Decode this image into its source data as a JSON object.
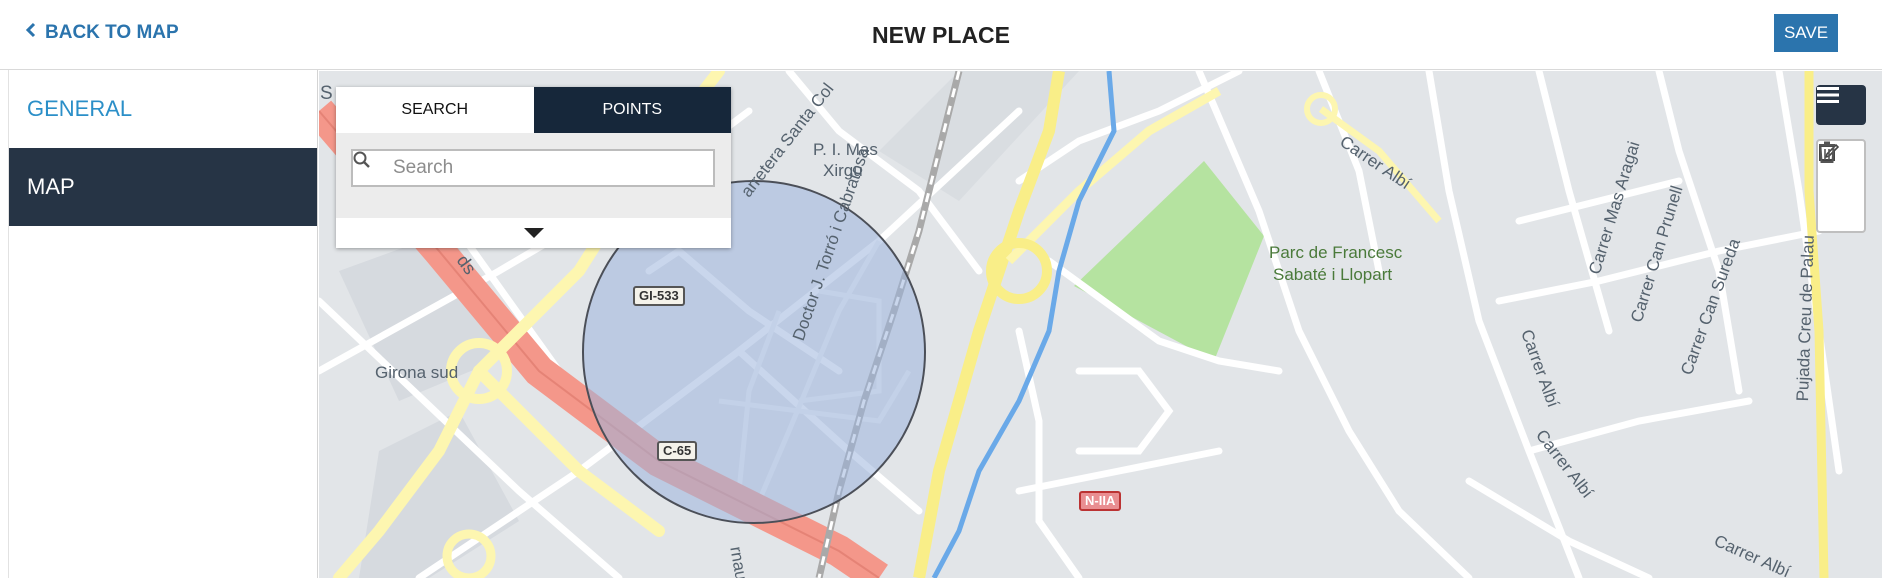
{
  "header": {
    "back_label": "BACK TO MAP",
    "title": "NEW PLACE",
    "save_label": "SAVE"
  },
  "sidebar": {
    "items": [
      {
        "label": "GENERAL",
        "active": false
      },
      {
        "label": "MAP",
        "active": true
      }
    ]
  },
  "panel": {
    "tabs": [
      {
        "label": "SEARCH",
        "active": true
      },
      {
        "label": "POINTS",
        "active": false
      }
    ],
    "search": {
      "placeholder": "Search",
      "value": ""
    }
  },
  "map": {
    "labels": {
      "mas_xirgu_1": "P. I. Mas",
      "mas_xirgu_2": "Xirgu",
      "girona_sud": "Girona sud",
      "parc_1": "Parc de Francesc",
      "parc_2": "Sabaté i Llopart",
      "doctor": "Doctor J. Torró i Cabratosa",
      "carretera": "arretera Santa Col",
      "carrer_albi_top": "Carrer Albí",
      "carrer_albi_mid": "Carrer Albí",
      "carrer_albi_low": "Carrer Albí",
      "carrer_albi_bottom": "Carrer Albí",
      "mas_aragai": "Carrer Mas Aragai",
      "can_prunell": "Carrer Can Prunell",
      "can_sureda": "Carrer Can Sureda",
      "creu_palau": "Pujada Creu de Palau",
      "snippet_left": "S",
      "snippet_ds": "ds",
      "snippet_rnau": "rnau"
    },
    "shields": {
      "gi533": "GI-533",
      "c65": "C-65",
      "n11a": "N-IIA"
    }
  },
  "icons": {
    "back": "chevron-left-icon",
    "search": "search-icon",
    "caret": "caret-down-icon",
    "layers": "layers-icon",
    "edit": "edit-icon",
    "trash": "trash-icon"
  },
  "colors": {
    "accent": "#2b74ad",
    "sidebar_active": "#263445",
    "points_tab": "#16273a",
    "highway": "#f4978a",
    "park": "#b5e3a0",
    "circle_fill": "#9db4dd"
  }
}
